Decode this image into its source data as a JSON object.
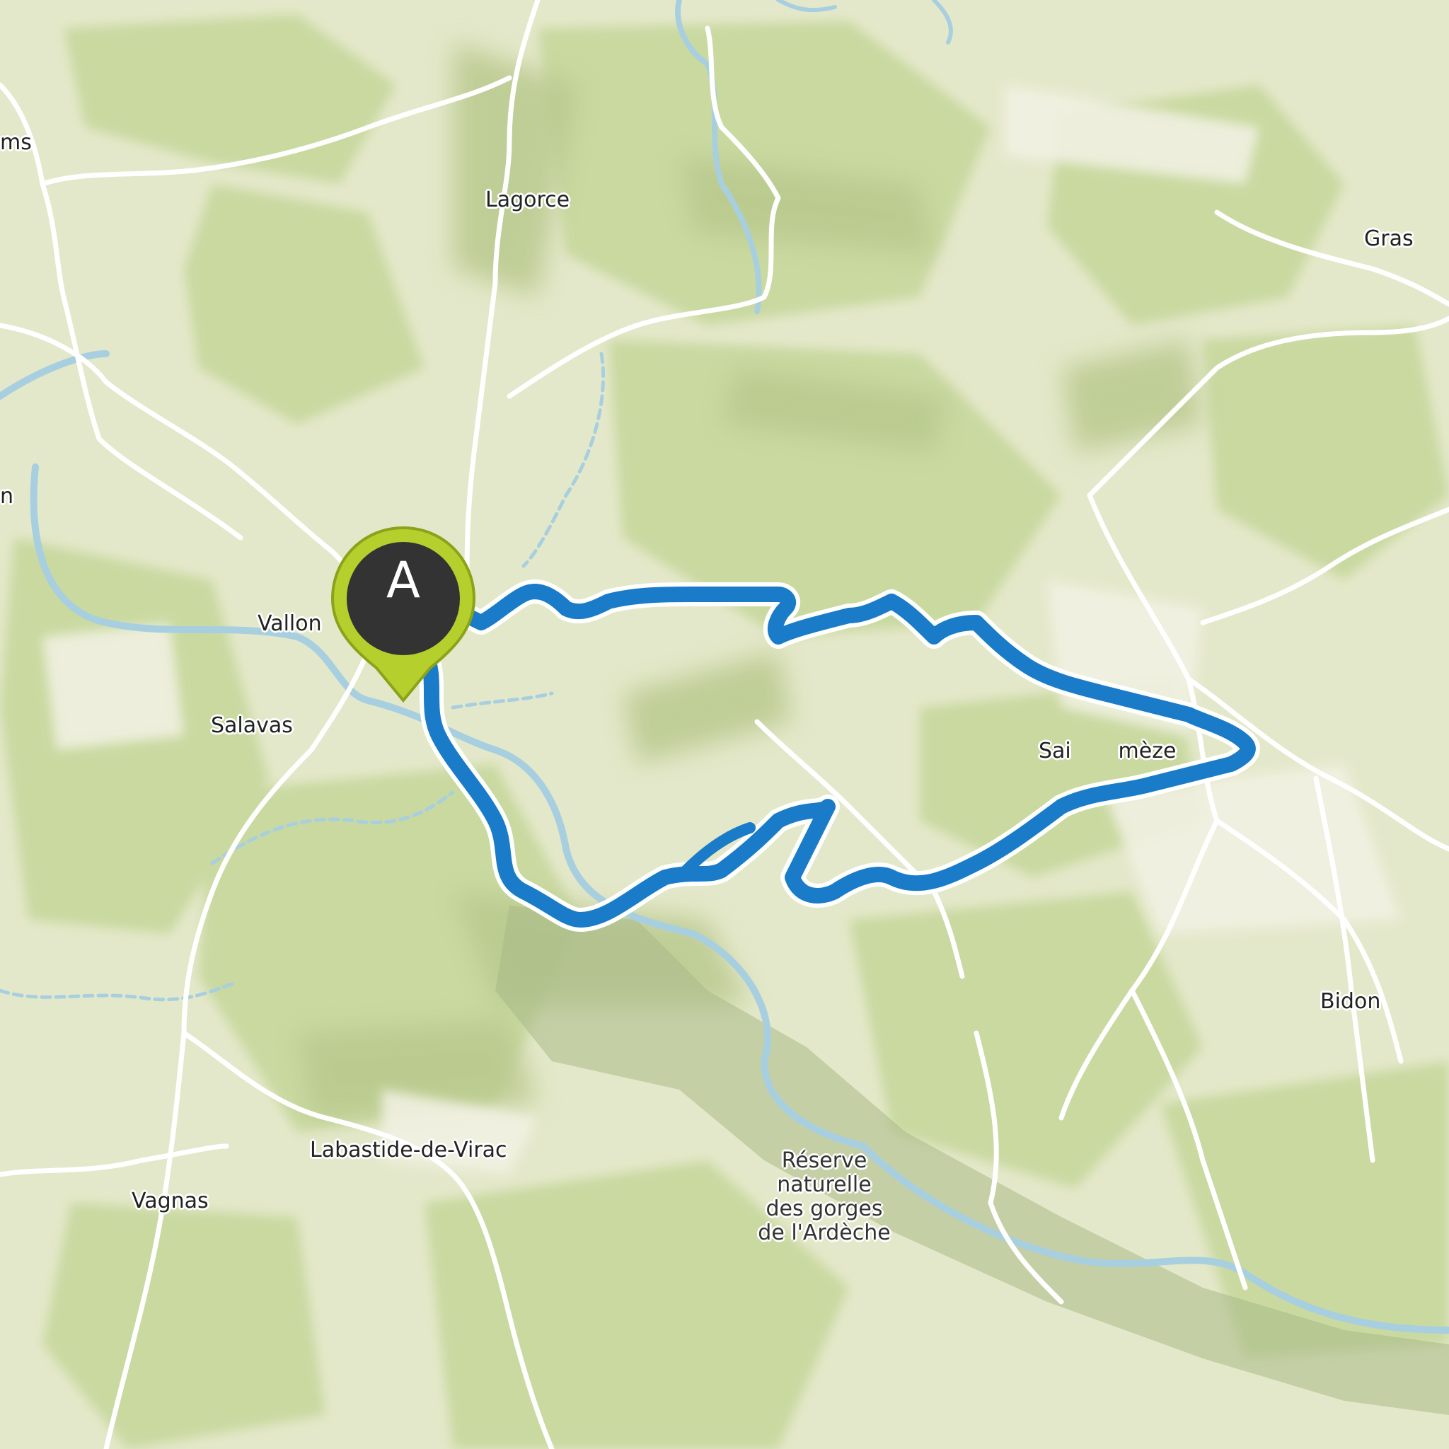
{
  "map": {
    "places": {
      "lagorce": "Lagorce",
      "gras": "Gras",
      "vallon": "Vallon",
      "salavas": "Salavas",
      "saint_remeze": "Sai       mèze",
      "bidon": "Bidon",
      "labastide": "Labastide-de-Virac",
      "vagnas": "Vagnas",
      "ms_edge": "ms",
      "n_edge": "n"
    },
    "reserve_label": [
      "Réserve",
      "naturelle",
      "des gorges",
      "de l'Ardèche"
    ],
    "marker": {
      "letter": "A",
      "color": "#b5cf2d",
      "inner": "#333333"
    },
    "route_color": "#1a7cc9",
    "river_color": "#a8cfe0"
  }
}
